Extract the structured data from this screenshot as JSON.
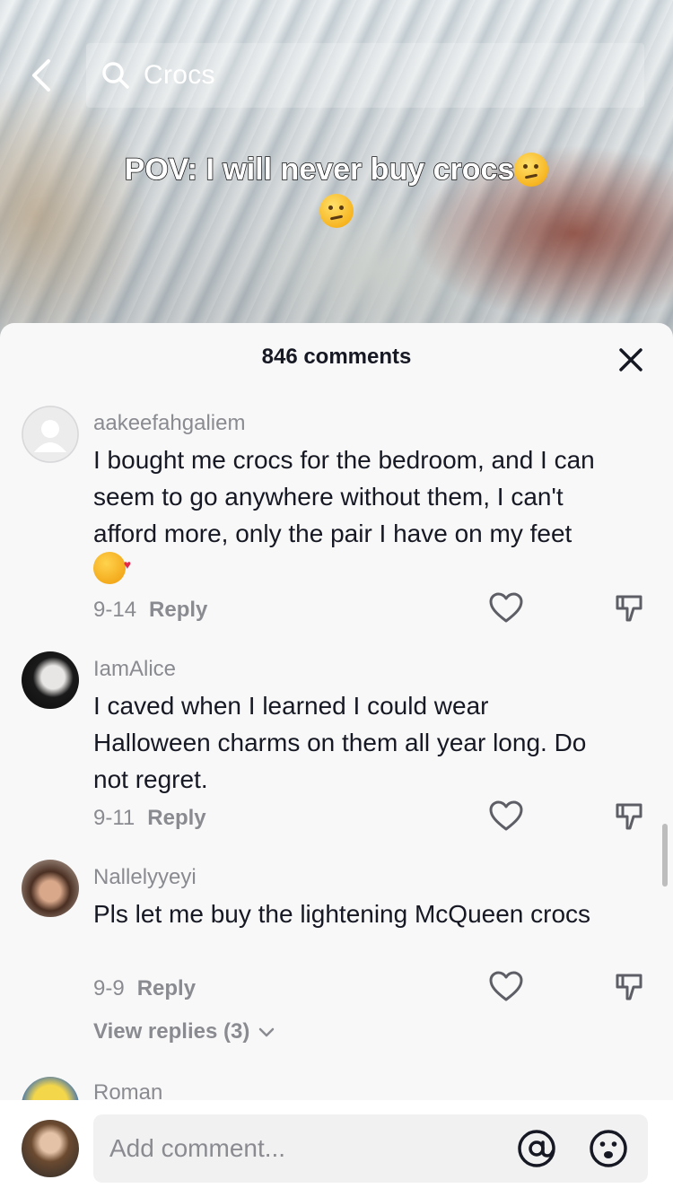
{
  "search": {
    "query": "Crocs"
  },
  "video": {
    "caption": "POV: I will never buy crocs"
  },
  "sheet": {
    "title": "846 comments"
  },
  "comments": [
    {
      "username": "aakeefahgaliem",
      "text": "I bought me crocs for the bedroom, and I can seem to go anywhere without them, I can't afford more, only the pair I have on my feet",
      "date": "9-14",
      "reply_label": "Reply"
    },
    {
      "username": "IamAlice",
      "text": "I caved when I learned I could wear Halloween charms on them all year long. Do not regret.",
      "date": "9-11",
      "reply_label": "Reply"
    },
    {
      "username": "Nallelyyeyi",
      "text": "Pls let me buy the lightening McQueen crocs",
      "date": "9-9",
      "reply_label": "Reply",
      "view_replies": "View replies (3)"
    },
    {
      "username": "Roman"
    }
  ],
  "composer": {
    "placeholder": "Add comment..."
  },
  "colors": {
    "text": "#161823",
    "muted": "#8a8b91",
    "sheet_bg": "#f8f8f8",
    "input_bg": "#f1f1f2"
  }
}
